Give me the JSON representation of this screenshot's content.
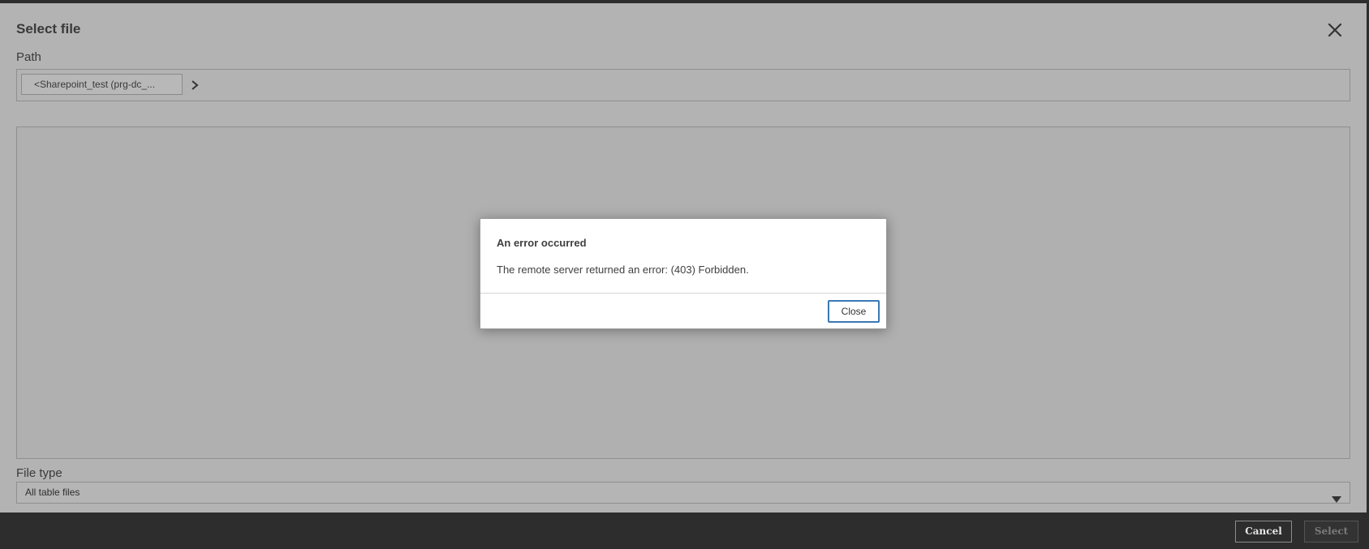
{
  "dialog": {
    "title": "Select file",
    "close_icon": "close-icon",
    "path_label": "Path",
    "breadcrumb": {
      "item": "<Sharepoint_test (prg-dc_...",
      "chevron_icon": "chevron-right-icon"
    },
    "file_type_label": "File type",
    "file_type_value": "All table files",
    "dropdown_icon": "caret-down-icon"
  },
  "footer": {
    "cancel_label": "Cancel",
    "select_label": "Select"
  },
  "error_modal": {
    "title": "An error occurred",
    "message": "The remote server returned an error: (403) Forbidden.",
    "close_label": "Close"
  },
  "colors": {
    "accent": "#3a78b7",
    "overlay": "#b3b3b3",
    "footer_bg": "#2d2d2d"
  }
}
